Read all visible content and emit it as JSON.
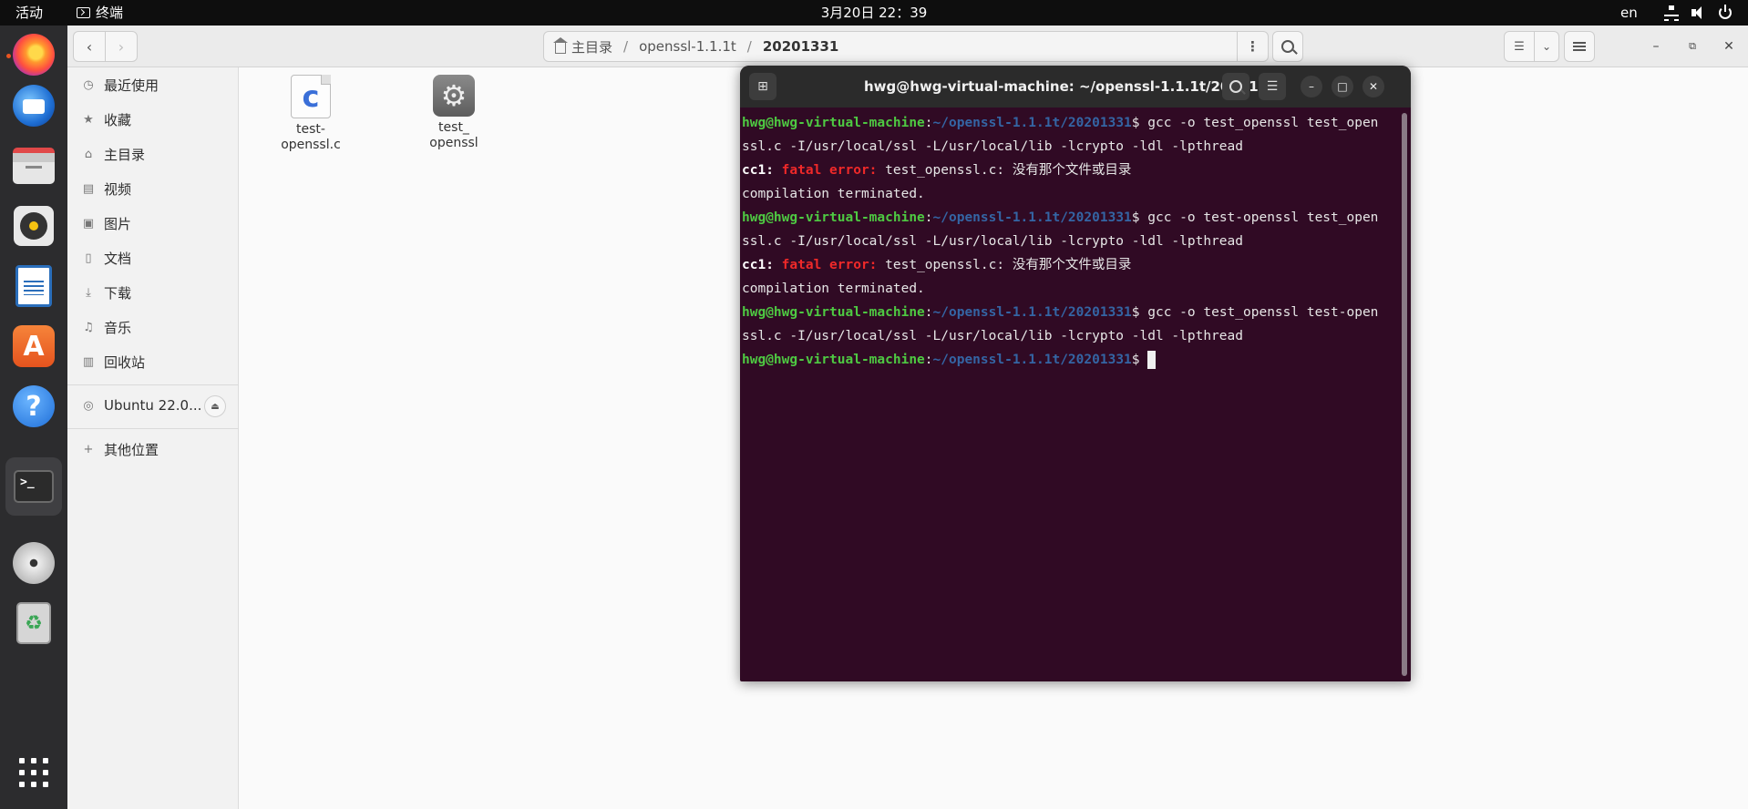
{
  "topbar": {
    "activities": "活动",
    "app_name": "终端",
    "clock": "3月20日  22：39",
    "lang": "en"
  },
  "dock": {
    "items": [
      "firefox-icon",
      "thunderbird-icon",
      "files-icon",
      "rhythmbox-icon",
      "writer-icon",
      "app-store-icon",
      "help-icon",
      "terminal-icon",
      "cd-icon",
      "trash-icon",
      "show-apps-icon"
    ],
    "store_glyph": "A",
    "help_glyph": "?",
    "term_glyph": ">_",
    "trash_glyph": "♻"
  },
  "files": {
    "path": [
      "主目录",
      "openssl-1.1.1t",
      "20201331"
    ],
    "sidebar": [
      {
        "icon": "◷",
        "label": "最近使用"
      },
      {
        "icon": "★",
        "label": "收藏"
      },
      {
        "icon": "⌂",
        "label": "主目录"
      },
      {
        "icon": "▤",
        "label": "视频"
      },
      {
        "icon": "▣",
        "label": "图片"
      },
      {
        "icon": "▯",
        "label": "文档"
      },
      {
        "icon": "⤓",
        "label": "下载"
      },
      {
        "icon": "♫",
        "label": "音乐"
      },
      {
        "icon": "▥",
        "label": "回收站"
      }
    ],
    "device": {
      "icon": "◎",
      "label": "Ubuntu 22.0..."
    },
    "other": {
      "icon": "+",
      "label": "其他位置"
    },
    "items": [
      {
        "label": "test-\nopenssl.c",
        "glyph": "c"
      },
      {
        "label": "test_\nopenssl",
        "glyph": "⚙"
      }
    ]
  },
  "terminal": {
    "title": "hwg@hwg-virtual-machine: ~/openssl-1.1.1t/20201331",
    "user_host": "hwg@hwg-virtual-machine",
    "cwd": "~/openssl-1.1.1t/20201331",
    "lines": [
      {
        "type": "prompt",
        "cmd": " gcc -o test_openssl test_open"
      },
      {
        "type": "text",
        "text": "ssl.c -I/usr/local/ssl -L/usr/local/lib -lcrypto -ldl -lpthread"
      },
      {
        "type": "error",
        "label": "cc1:",
        "err": "fatal error:",
        "msg": " test_openssl.c: 没有那个文件或目录"
      },
      {
        "type": "text",
        "text": "compilation terminated."
      },
      {
        "type": "prompt",
        "cmd": " gcc -o test-openssl test_open"
      },
      {
        "type": "text",
        "text": "ssl.c -I/usr/local/ssl -L/usr/local/lib -lcrypto -ldl -lpthread"
      },
      {
        "type": "error",
        "label": "cc1:",
        "err": "fatal error:",
        "msg": " test_openssl.c: 没有那个文件或目录"
      },
      {
        "type": "text",
        "text": "compilation terminated."
      },
      {
        "type": "prompt",
        "cmd": " gcc -o test_openssl test-open"
      },
      {
        "type": "text",
        "text": "ssl.c -I/usr/local/ssl -L/usr/local/lib -lcrypto -ldl -lpthread"
      },
      {
        "type": "prompt_cursor",
        "cmd": " "
      }
    ]
  }
}
